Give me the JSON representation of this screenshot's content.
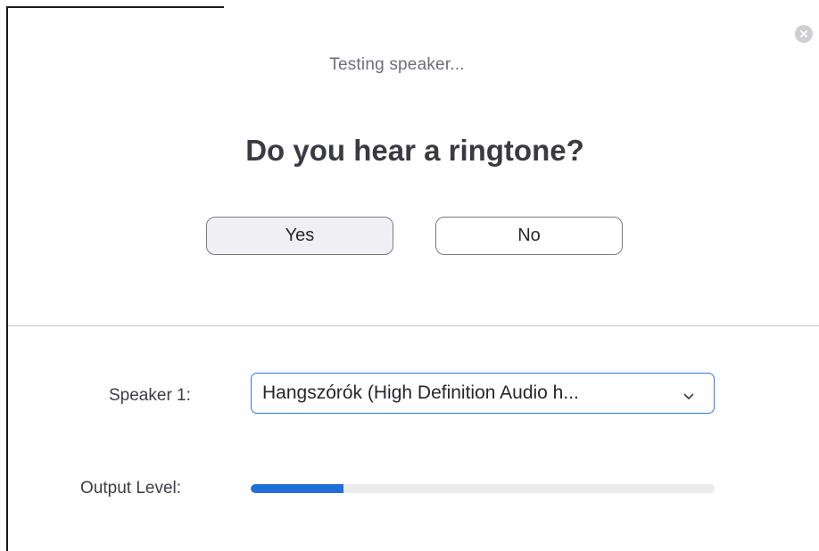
{
  "dialog": {
    "subtitle": "Testing speaker...",
    "question": "Do you hear a ringtone?",
    "yes_label": "Yes",
    "no_label": "No",
    "close_icon": "close-icon"
  },
  "speaker": {
    "label": "Speaker 1:",
    "selected_value": "Hangszórók (High Definition Audio h...",
    "dropdown_icon": "chevron-down-icon"
  },
  "output": {
    "label": "Output Level:",
    "level_fraction": 0.2
  },
  "colors": {
    "accent": "#2d7be5",
    "level_fill": "#1f6fd8",
    "level_track": "#ebebee"
  }
}
